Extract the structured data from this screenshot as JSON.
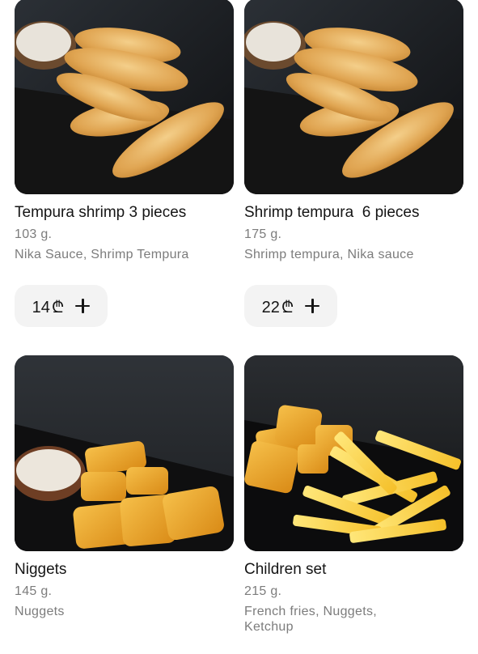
{
  "products": [
    {
      "name": "Tempura shrimp 3 pieces",
      "weight": "103 g.",
      "ingredients": "Nika Sauce, Shrimp Tempura",
      "price": "14",
      "currency": "₾",
      "add_icon": "plus-icon",
      "image": "shrimp-tempura-photo"
    },
    {
      "name": "Shrimp tempura  6 pieces",
      "weight": "175 g.",
      "ingredients": "Shrimp tempura, Nika sauce",
      "price": "22",
      "currency": "₾",
      "add_icon": "plus-icon",
      "image": "shrimp-tempura-photo"
    },
    {
      "name": "Niggets",
      "weight": "145 g.",
      "ingredients": "Nuggets",
      "image": "nuggets-photo"
    },
    {
      "name": "Children set",
      "weight": "215 g.",
      "ingredients": "French fries, Nuggets, Ketchup",
      "image": "children-set-photo"
    }
  ],
  "colors": {
    "price_button_bg": "#f3f3f3",
    "text_primary": "#151515",
    "text_secondary": "#7c7c7c",
    "photo_bg": "#17191c"
  }
}
